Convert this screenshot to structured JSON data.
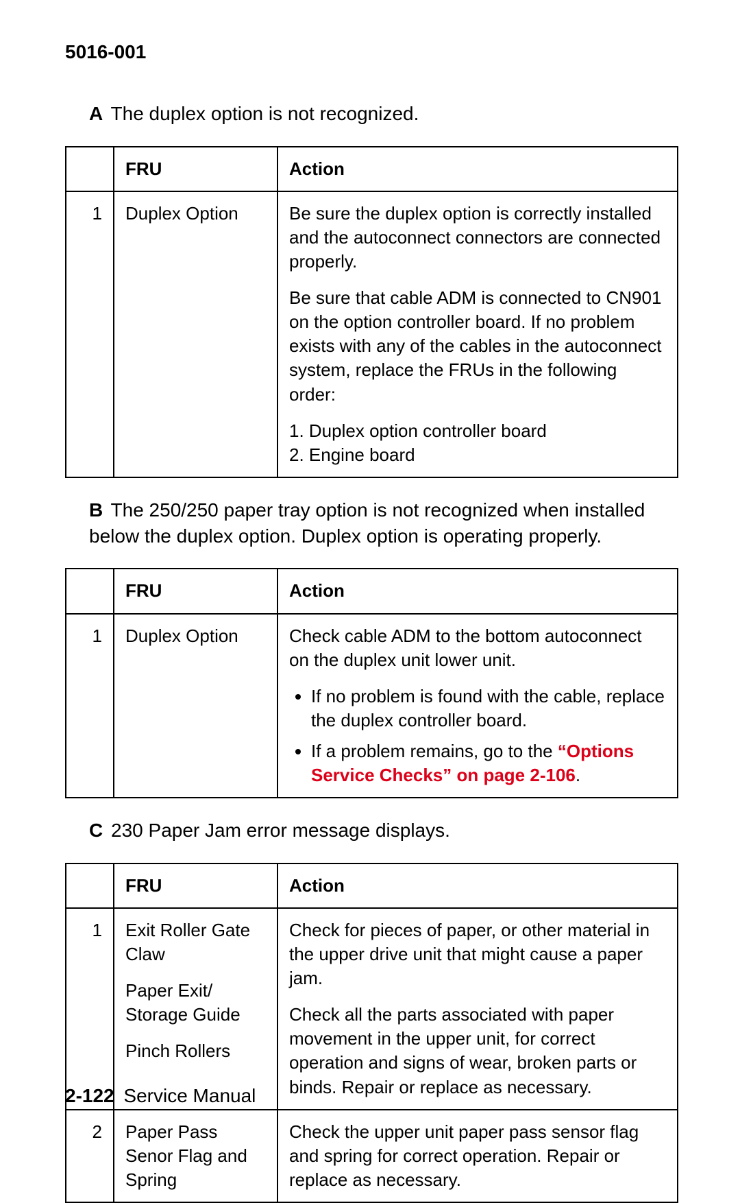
{
  "header": {
    "model": "5016-001"
  },
  "sections": {
    "A": {
      "letter": "A",
      "text": "The duplex option is not recognized.",
      "table": {
        "headers": {
          "fru": "FRU",
          "action": "Action"
        },
        "rows": [
          {
            "num": "1",
            "fru": "Duplex Option",
            "action_p1": "Be sure the duplex option is correctly installed and the autoconnect connectors are connected properly.",
            "action_p2": "Be sure that cable ADM is connected to CN901 on the option controller board. If no problem exists with any of the cables in the autoconnect system, replace the FRUs in the following order:",
            "action_p3": "1. Duplex option controller board\n2. Engine board"
          }
        ]
      }
    },
    "B": {
      "letter": "B",
      "text": "The 250/250 paper tray option is not recognized when installed below the duplex option. Duplex option is operating properly.",
      "table": {
        "headers": {
          "fru": "FRU",
          "action": "Action"
        },
        "rows": [
          {
            "num": "1",
            "fru": "Duplex Option",
            "action_p1": "Check cable ADM to the bottom autoconnect on the duplex unit lower unit.",
            "bullet1": "If no problem is found with the cable, replace the duplex controller board.",
            "bullet2_prefix": "If a problem remains, go to the ",
            "bullet2_link": "“Options Service Checks” on page 2-106",
            "bullet2_suffix": "."
          }
        ]
      }
    },
    "C": {
      "letter": "C",
      "text": "230 Paper Jam error message displays.",
      "table": {
        "headers": {
          "fru": "FRU",
          "action": "Action"
        },
        "rows": [
          {
            "num": "1",
            "fru1": "Exit Roller Gate Claw",
            "fru2": "Paper Exit/ Storage Guide",
            "fru3": "Pinch Rollers",
            "action_p1": "Check for pieces of paper, or other material in the upper drive unit that might cause a paper jam.",
            "action_p2": "Check all the parts associated with paper movement in the upper unit, for correct operation and signs of wear, broken parts or binds. Repair or replace as necessary."
          },
          {
            "num": "2",
            "fru1": "Paper Pass Senor Flag and Spring",
            "action_p1": "Check the upper unit paper pass sensor flag and spring for correct operation. Repair or replace as necessary."
          }
        ]
      }
    }
  },
  "footer": {
    "page": "2-122",
    "label": "Service Manual"
  }
}
